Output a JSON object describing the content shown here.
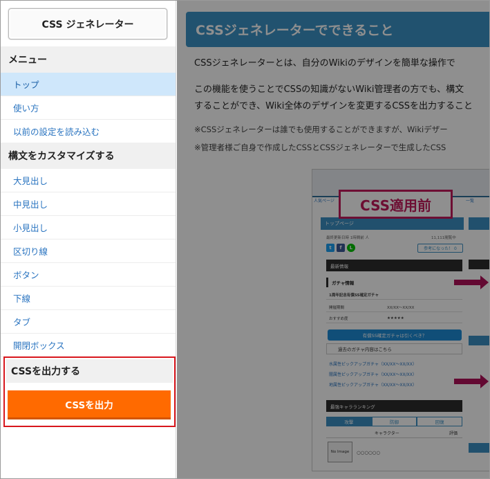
{
  "sidebar": {
    "title_button": "CSS ジェネレーター",
    "menu_heading": "メニュー",
    "menu_items": [
      {
        "label": "トップ",
        "active": true
      },
      {
        "label": "使い方",
        "active": false
      },
      {
        "label": "以前の設定を読み込む",
        "active": false
      }
    ],
    "customize_heading": "構文をカスタマイズする",
    "customize_items": [
      {
        "label": "大見出し"
      },
      {
        "label": "中見出し"
      },
      {
        "label": "小見出し"
      },
      {
        "label": "区切り線"
      },
      {
        "label": "ボタン"
      },
      {
        "label": "下線"
      },
      {
        "label": "タブ"
      },
      {
        "label": "開閉ボックス"
      }
    ],
    "output_heading": "CSSを出力する",
    "output_button": "CSSを出力"
  },
  "main": {
    "title": "CSSジェネレーターでできること",
    "para1": "CSSジェネレーターとは、自分のWikiのデザインを簡単な操作で",
    "para2_line1": "この機能を使うことでCSSの知識がないWiki管理者の方でも、構文",
    "para2_line2": "することができ、Wiki全体のデザインを変更するCSSを出力すること",
    "note1": "※CSSジェネレーターは誰でも使用することができますが、Wikiデザー",
    "note2": "※管理者様ご自身で作成したCSSとCSSジェネレーターで生成したCSS",
    "preview": {
      "badge": "CSS適用前",
      "crumb_left": "人気ページ",
      "crumb_right": "一覧",
      "page_header": "トップページ",
      "meta_left": "最終更新日時 1時間前 人",
      "meta_right": "11,111閲覧中",
      "helpful_button": "参考になった！ 0",
      "news_heading": "最新情報",
      "gacha_heading": "ガチャ情報",
      "gacha_item": "1周年記念有償SS確定ガチャ",
      "period_label": "開催期間",
      "period_value": "XX/XX〜XX/XX",
      "recommend_label": "おすすめ度",
      "recommend_value": "★★★★★",
      "cta_button": "有償SS確定ガチャは引くべき？",
      "past_toggle": "過去のガチャ内容はこちら",
      "links": [
        "水属性ピックアップガチャ（XX/XX〜XX/XX）",
        "闇属性ピックアップガチャ（XX/XX〜XX/XX）",
        "地属性ピックアップガチャ（XX/XX〜XX/XX）"
      ],
      "ranking_heading": "最強キャラランキング",
      "tabs": [
        "攻撃",
        "防御",
        "回復"
      ],
      "rank_col_char": "キャラクター",
      "rank_col_eval": "評価",
      "no_image": "No Image",
      "row_name": "○○○○○○"
    }
  },
  "colors": {
    "accent_orange": "#ff6a00",
    "highlight_red": "#d8161c",
    "title_blue": "#3c93c7",
    "active_bg": "#cfe7fb",
    "badge_magenta": "#c21a5c"
  }
}
